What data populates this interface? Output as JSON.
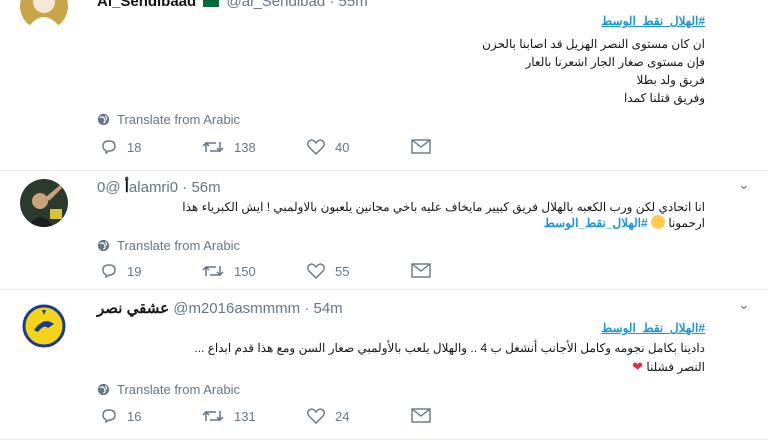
{
  "tweets": [
    {
      "display_name": "Al_Sendibaad",
      "handle": "@al_Sendibad",
      "time": "55m",
      "hashtag": "#الهلال_نقط_الوسط",
      "lines": [
        "ان كان مستوى النصر الهزيل قد اصابنا بالحزن",
        "فإن مستوى صغار الجار اشعرنا بالعار",
        "فريق ولد بطلا",
        "وفريق قتلنا كمدا"
      ],
      "translate": "Translate from Arabic",
      "replies": "18",
      "retweets": "138",
      "likes": "40"
    },
    {
      "display_name": "أ",
      "handle": "@0alamri0",
      "time": "56m",
      "lines": [
        "انا اتحادي لكن ورب الكعبه بالهلال فريق كبيير مايخاف عليه باخي مجانين يلعبون بالاولمبي ! ايش الكبرياء هذا",
        "ارحمونا",
        "#الهلال_نقط_الوسط"
      ],
      "translate": "Translate from Arabic",
      "replies": "19",
      "retweets": "150",
      "likes": "55"
    },
    {
      "display_name": "عشقي نصر",
      "handle": "@m2016asmmmm",
      "time": "54m",
      "hashtag": "#الهلال_نقط_الوسط",
      "lines": [
        "دادينا بكامل نجومه وكامل الأجانب أنشغل ب 4 .. والهلال يلعب بالأولمبي صغار السن ومع هذا قدم ابداع ...",
        "النصر فشلنا"
      ],
      "translate": "Translate from Arabic",
      "replies": "16",
      "retweets": "131",
      "likes": "24"
    }
  ],
  "sep": "·",
  "colors": {
    "link": "#1b95e0",
    "muted": "#657786",
    "border": "#e6ecf0"
  },
  "icons": [
    "avatar",
    "globe-icon",
    "reply-icon",
    "retweet-icon",
    "like-icon",
    "message-icon",
    "chevron-down-icon",
    "flag-icon"
  ]
}
